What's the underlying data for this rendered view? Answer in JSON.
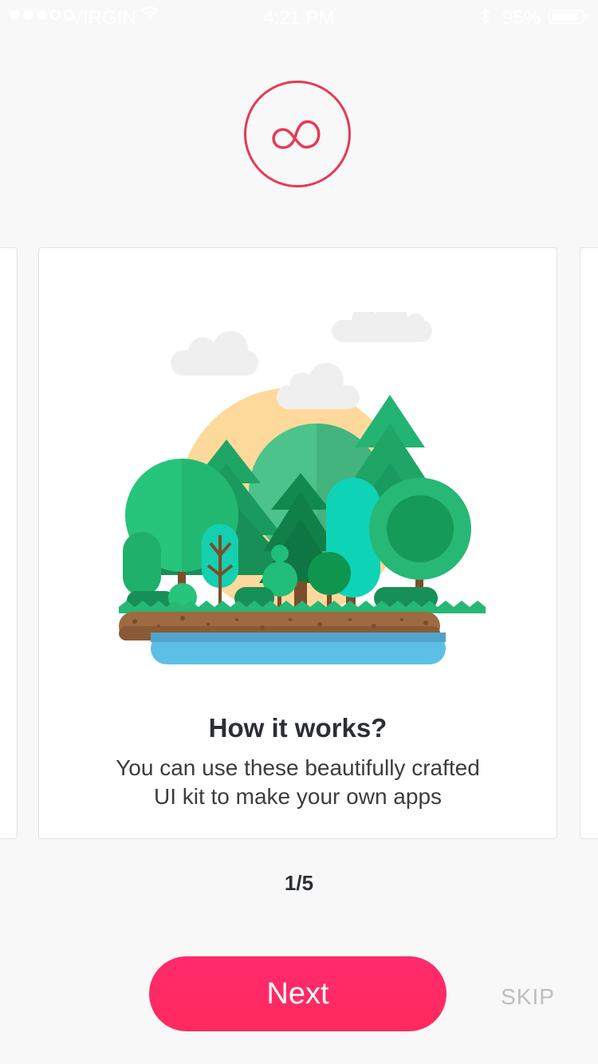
{
  "status_bar": {
    "carrier": "VIRGIN",
    "time": "4:21 PM",
    "battery": "95%",
    "battery_level": 0.95,
    "icons": [
      "signal-dots-icon",
      "wifi-icon",
      "bluetooth-icon",
      "battery-icon"
    ]
  },
  "logo": {
    "icon": "infinity-loop-icon",
    "color": "#e53a55"
  },
  "card": {
    "illustration": "forest-island-illustration",
    "title": "How it works?",
    "description_lines": [
      "You can use these beautifully crafted",
      "UI kit to make your own apps"
    ]
  },
  "pager": {
    "text": "1/5",
    "current": 1,
    "total": 5
  },
  "actions": {
    "next_label": "Next",
    "skip_label": "SKIP"
  },
  "colors": {
    "accent": "#ff2a64",
    "logo": "#e53a55",
    "background": "#f8f8f8"
  }
}
